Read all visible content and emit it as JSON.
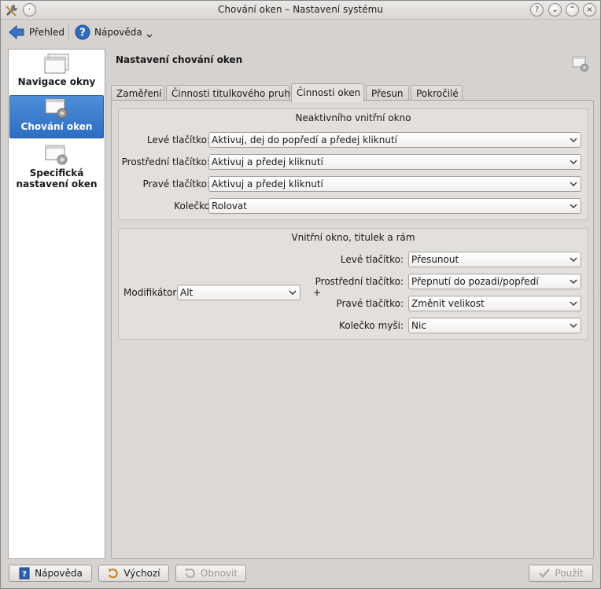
{
  "window": {
    "title": "Chování oken – Nastavení systému",
    "icons": [
      "tools-icon",
      "pin-icon"
    ],
    "controls": [
      "help-icon",
      "minimize-icon",
      "maximize-icon",
      "close-icon"
    ]
  },
  "toolbar": {
    "back_label": "Přehled",
    "help_label": "Nápověda"
  },
  "sidebar": {
    "items": [
      {
        "label_line1": "Navigace okny",
        "label_line2": ""
      },
      {
        "label_line1": "Chování oken",
        "label_line2": ""
      },
      {
        "label_line1": "Specifická",
        "label_line2": "nastavení oken"
      }
    ]
  },
  "main": {
    "title": "Nastavení chování oken",
    "tabs": [
      {
        "label": "Zaměření"
      },
      {
        "label": "Činnosti titulkového pruhu"
      },
      {
        "label": "Činnosti oken"
      },
      {
        "label": "Přesun"
      },
      {
        "label": "Pokročilé"
      }
    ],
    "active_tab": "Činnosti oken"
  },
  "inactive_group": {
    "title": "Neaktivního vnitřní okno",
    "rows": [
      {
        "label": "Levé tlačítko:",
        "value": "Aktivuj, dej do popředí a předej kliknutí"
      },
      {
        "label": "Prostřední tlačítko:",
        "value": "Aktivuj a předej kliknutí"
      },
      {
        "label": "Pravé tlačítko:",
        "value": "Aktivuj a předej kliknutí"
      },
      {
        "label": "Kolečko",
        "value": "Rolovat"
      }
    ]
  },
  "frame_group": {
    "title": "Vnitřní okno, titulek a rám",
    "modifier_label": "Modifikátor:",
    "modifier_value": "Alt",
    "plus": "+",
    "rows": [
      {
        "label": "Levé tlačítko:",
        "value": "Přesunout"
      },
      {
        "label": "Prostřední tlačítko:",
        "value": "Přepnutí do pozadí/popředí"
      },
      {
        "label": "Pravé tlačítko:",
        "value": "Změnit velikost"
      },
      {
        "label": "Kolečko myši:",
        "value": "Nic"
      }
    ]
  },
  "buttons": {
    "help": "Nápověda",
    "defaults": "Výchozí",
    "reset": "Obnovit",
    "apply": "Použít"
  }
}
